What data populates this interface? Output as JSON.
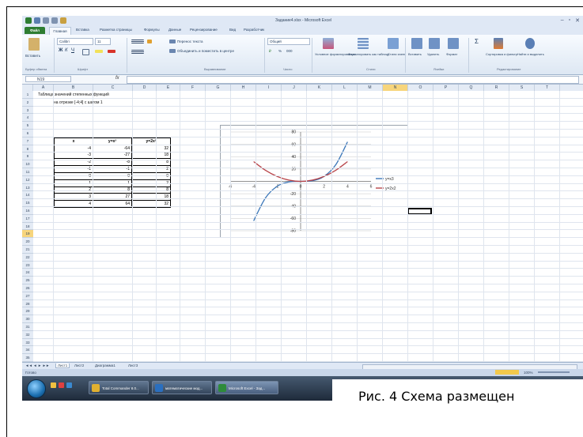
{
  "window": {
    "title": "Задание4.xlsx - Microsoft Excel",
    "minimize_glyph": "–",
    "restore_glyph": "▫",
    "close_glyph": "✕"
  },
  "menu": {
    "tabs": [
      "Файл",
      "Главная",
      "Вставка",
      "Разметка страницы",
      "Формулы",
      "Данные",
      "Рецензирование",
      "Вид",
      "Разработчик"
    ],
    "active_tab": "Главная"
  },
  "ribbon": {
    "clipboard": {
      "paste": "Вставить",
      "label": "Буфер обмена"
    },
    "font": {
      "name": "Calibri",
      "size": "11",
      "label": "Шрифт"
    },
    "alignment": {
      "wrap": "Перенос текста",
      "merge": "Объединить и поместить в центре",
      "label": "Выравнивание"
    },
    "number": {
      "format": "Общий",
      "label": "Число"
    },
    "styles": {
      "conditional": "Условное форматирование",
      "as_table": "Форматировать как таблицу",
      "cell_styles": "Стили ячеек",
      "label": "Стили"
    },
    "cells": {
      "insert": "Вставить",
      "delete": "Удалить",
      "format": "Формат",
      "label": "Ячейки"
    },
    "editing": {
      "sort": "Сортировка и фильтр",
      "find": "Найти и выделить",
      "label": "Редактирование"
    }
  },
  "formula_bar": {
    "name_box": "N19",
    "fx": "fx",
    "value": ""
  },
  "columns": [
    "A",
    "B",
    "C",
    "D",
    "E",
    "F",
    "G",
    "H",
    "I",
    "J",
    "K",
    "L",
    "M",
    "N",
    "O",
    "P",
    "Q",
    "R",
    "S",
    "T"
  ],
  "selected_column": "N",
  "rows": [
    "1",
    "2",
    "3",
    "4",
    "5",
    "6",
    "7",
    "8",
    "9",
    "10",
    "11",
    "12",
    "13",
    "14",
    "15",
    "16",
    "17",
    "18",
    "19",
    "20",
    "21",
    "22",
    "23",
    "24",
    "25",
    "26",
    "27",
    "28",
    "29",
    "30",
    "31",
    "32",
    "33",
    "34",
    "35"
  ],
  "selected_row": "19",
  "sheet_title": {
    "line1": "Таблица значений степенных функций",
    "line2": "на отрезке [-4;4] с шагом 1"
  },
  "table": {
    "headers": [
      "x",
      "y=x³",
      "y=2x²"
    ],
    "rows": [
      [
        "-4",
        "-64",
        "32"
      ],
      [
        "-3",
        "-27",
        "18"
      ],
      [
        "-2",
        "-8",
        "8"
      ],
      [
        "-1",
        "-1",
        "2"
      ],
      [
        "0",
        "0",
        "0"
      ],
      [
        "1",
        "1",
        "2"
      ],
      [
        "2",
        "8",
        "8"
      ],
      [
        "3",
        "27",
        "18"
      ],
      [
        "4",
        "64",
        "32"
      ]
    ]
  },
  "chart_data": {
    "type": "line",
    "title": "",
    "xlabel": "",
    "ylabel": "",
    "xlim": [
      -6,
      6
    ],
    "ylim": [
      -80,
      80
    ],
    "x_ticks": [
      -6,
      -4,
      -2,
      0,
      2,
      4,
      6
    ],
    "y_ticks": [
      -80,
      -60,
      -40,
      -20,
      0,
      20,
      40,
      60,
      80
    ],
    "x": [
      -4,
      -3,
      -2,
      -1,
      0,
      1,
      2,
      3,
      4
    ],
    "series": [
      {
        "name": "y=x3",
        "values": [
          -64,
          -27,
          -8,
          -1,
          0,
          1,
          8,
          27,
          64
        ],
        "color": "#3a76b8"
      },
      {
        "name": "y=2x2",
        "values": [
          32,
          18,
          8,
          2,
          0,
          2,
          8,
          18,
          32
        ],
        "color": "#b8454a"
      }
    ],
    "grid": "horizontal",
    "legend": "right"
  },
  "sheet_tabs": [
    "Лист1",
    "Лист2",
    "Диаграмма1",
    "Лист3"
  ],
  "active_sheet": "Лист1",
  "status": {
    "ready": "Готово",
    "zoom": "100%"
  },
  "taskbar": {
    "items": [
      {
        "label": "Total Commander 8.0...",
        "color": "#e0b030"
      },
      {
        "label": "математические мод...",
        "color": "#2a6fbf"
      },
      {
        "label": "Microsoft Excel - Зад...",
        "color": "#2e8b3a"
      }
    ]
  },
  "caption": "Рис. 4 Схема размещен"
}
